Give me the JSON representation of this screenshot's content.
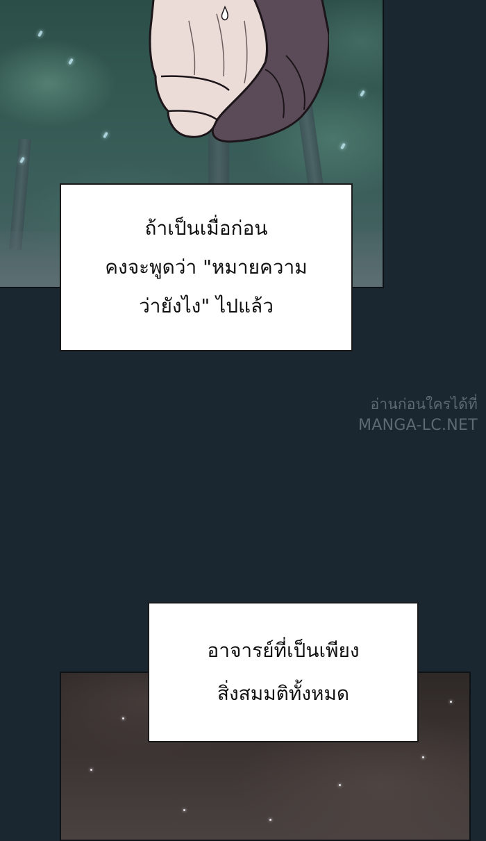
{
  "narration_top": {
    "line1": "ถ้าเป็นเมื่อก่อน",
    "line2": "คงจะพูดว่า \"หมายความ",
    "line3": "ว่ายังไง\" ไปแล้ว"
  },
  "narration_bottom": {
    "line1": "อาจารย์ที่เป็นเพียง",
    "line2": "สิ่งสมมติทั้งหมด"
  },
  "watermark": {
    "line1": "อ่านก่อนใครได้ที่",
    "line2": "MANGA-LC.NET"
  },
  "colors": {
    "gutter": "#1a2730",
    "watermark": "#5d6a72",
    "narration_bg": "#ffffff",
    "narration_text": "#111111"
  }
}
